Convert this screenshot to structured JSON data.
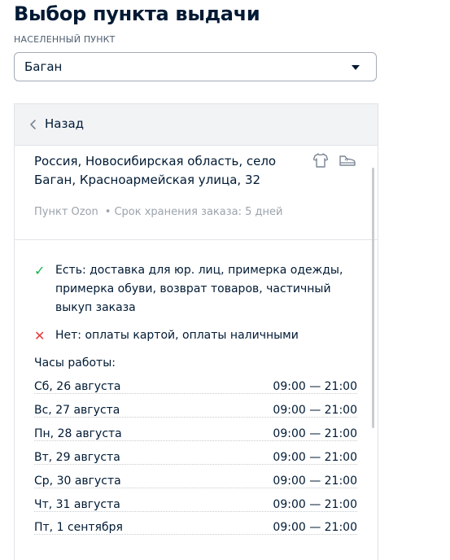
{
  "page": {
    "title": "Выбор пункта выдачи",
    "city_label": "НАСЕЛЕННЫЙ ПУНКТ",
    "city_value": "Баган"
  },
  "panel": {
    "back_label": "Назад",
    "address": "Россия, Новосибирская область, село Баган, Красноармейская улица, 32",
    "icons": [
      "shirt-icon",
      "shoe-icon"
    ],
    "point_type": "Пункт Ozon",
    "storage": "Срок хранения заказа: 5 дней",
    "available": "Есть: доставка для юр. лиц, примерка одежды, примерка обуви, возврат товаров, частичный выкуп заказа",
    "unavailable": "Нет: оплаты картой, оплаты наличными",
    "hours_title": "Часы работы:",
    "hours": [
      {
        "day": "Сб, 26 августа",
        "time": "09:00 — 21:00"
      },
      {
        "day": "Вс, 27 августа",
        "time": "09:00 — 21:00"
      },
      {
        "day": "Пн, 28 августа",
        "time": "09:00 — 21:00"
      },
      {
        "day": "Вт, 29 августа",
        "time": "09:00 — 21:00"
      },
      {
        "day": "Ср, 30 августа",
        "time": "09:00 — 21:00"
      },
      {
        "day": "Чт, 31 августа",
        "time": "09:00 — 21:00"
      },
      {
        "day": "Пт, 1 сентября",
        "time": "09:00 — 21:00"
      }
    ]
  },
  "colors": {
    "text": "#001a34",
    "muted": "#9ba3ad",
    "check": "#10b44c",
    "cross": "#e33a38",
    "header_bg": "#f2f3f5"
  }
}
